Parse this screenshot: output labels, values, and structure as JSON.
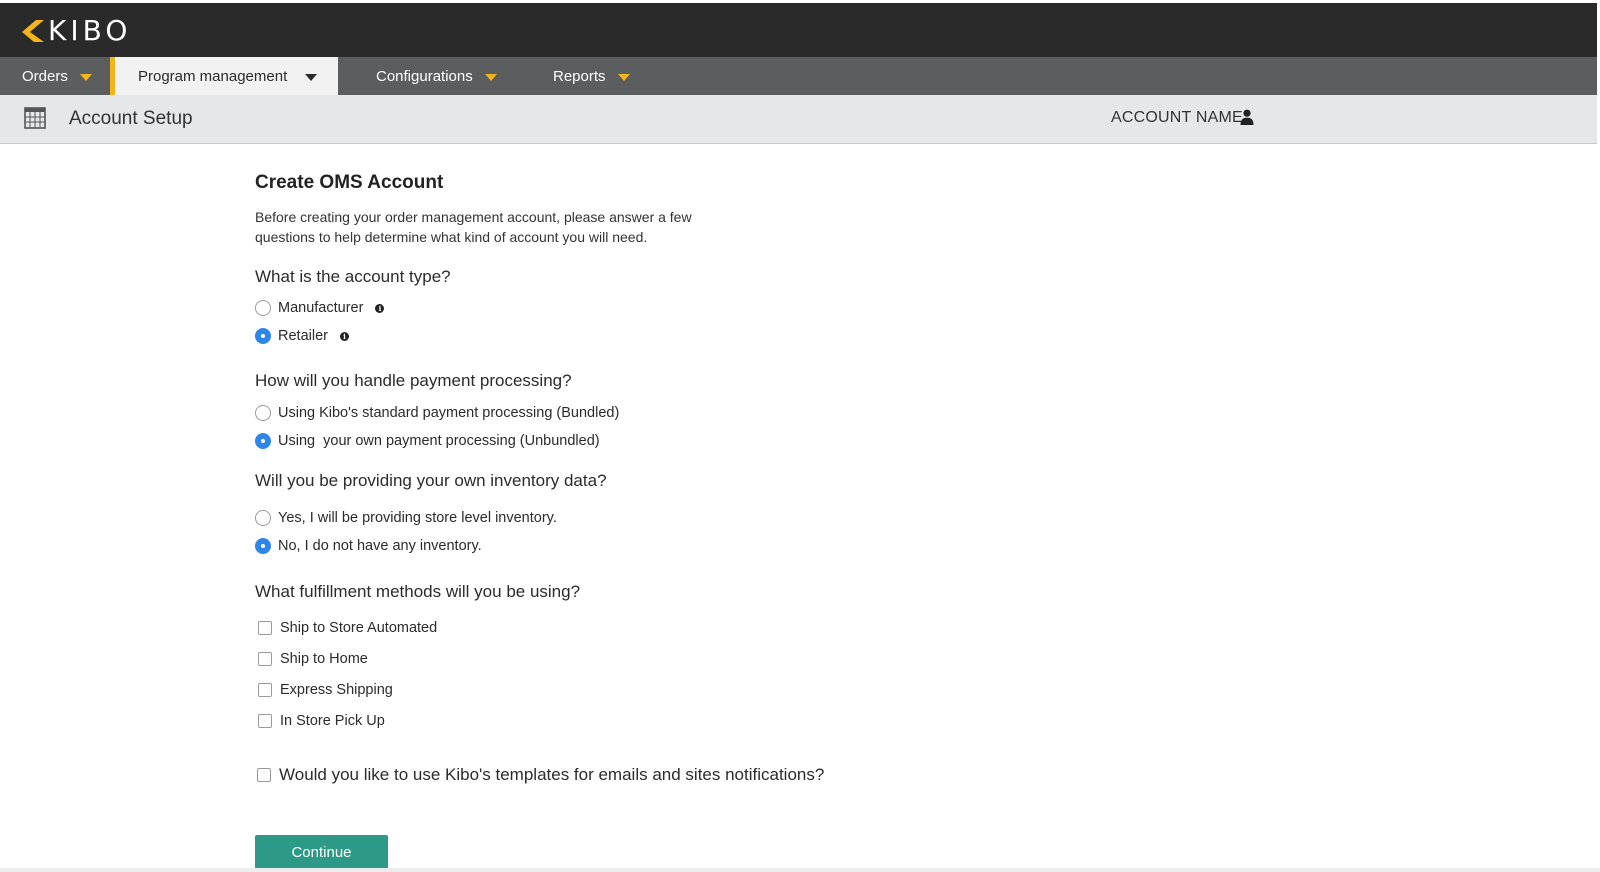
{
  "header": {
    "logo_text": "KIBO",
    "brand_color": "#f3b51b"
  },
  "nav": {
    "items": [
      {
        "label": "Orders",
        "active": false
      },
      {
        "label": "Program management",
        "active": true
      },
      {
        "label": "Configurations",
        "active": false
      },
      {
        "label": "Reports",
        "active": false
      }
    ]
  },
  "subheader": {
    "page_title": "Account Setup",
    "account_name": "ACCOUNT NAME",
    "page_icon": "calendar-grid-icon",
    "user_icon": "user-icon"
  },
  "form": {
    "title": "Create OMS Account",
    "intro": "Before creating your order management account, please answer a few questions to help determine what kind of account you will need.",
    "account_type": {
      "question": "What is the account type?",
      "options": [
        {
          "label": "Manufacturer",
          "checked": false
        },
        {
          "label": "Retailer",
          "checked": true
        }
      ]
    },
    "payment": {
      "question": "How will you handle payment processing?",
      "options": [
        {
          "label": "Using Kibo's standard payment processing (Bundled)",
          "checked": false
        },
        {
          "label": "Using  your own payment processing (Unbundled)",
          "checked": true
        }
      ]
    },
    "inventory": {
      "question": "Will you be providing your own inventory data?",
      "options": [
        {
          "label": "Yes, I will be providing store level inventory.",
          "checked": false
        },
        {
          "label": "No, I do not have any inventory.",
          "checked": true
        }
      ]
    },
    "fulfillment": {
      "question": "What fulfillment methods will you be using?",
      "options": [
        {
          "label": "Ship to Store Automated",
          "checked": false
        },
        {
          "label": "Ship to Home",
          "checked": false
        },
        {
          "label": "Express Shipping",
          "checked": false
        },
        {
          "label": "In Store Pick Up",
          "checked": false
        }
      ]
    },
    "templates": {
      "label": "Would you like to use Kibo's templates for emails and sites notifications?",
      "checked": false
    },
    "continue_label": "Continue",
    "accent_color": "#2d9a87",
    "radio_color": "#2e86e8"
  }
}
